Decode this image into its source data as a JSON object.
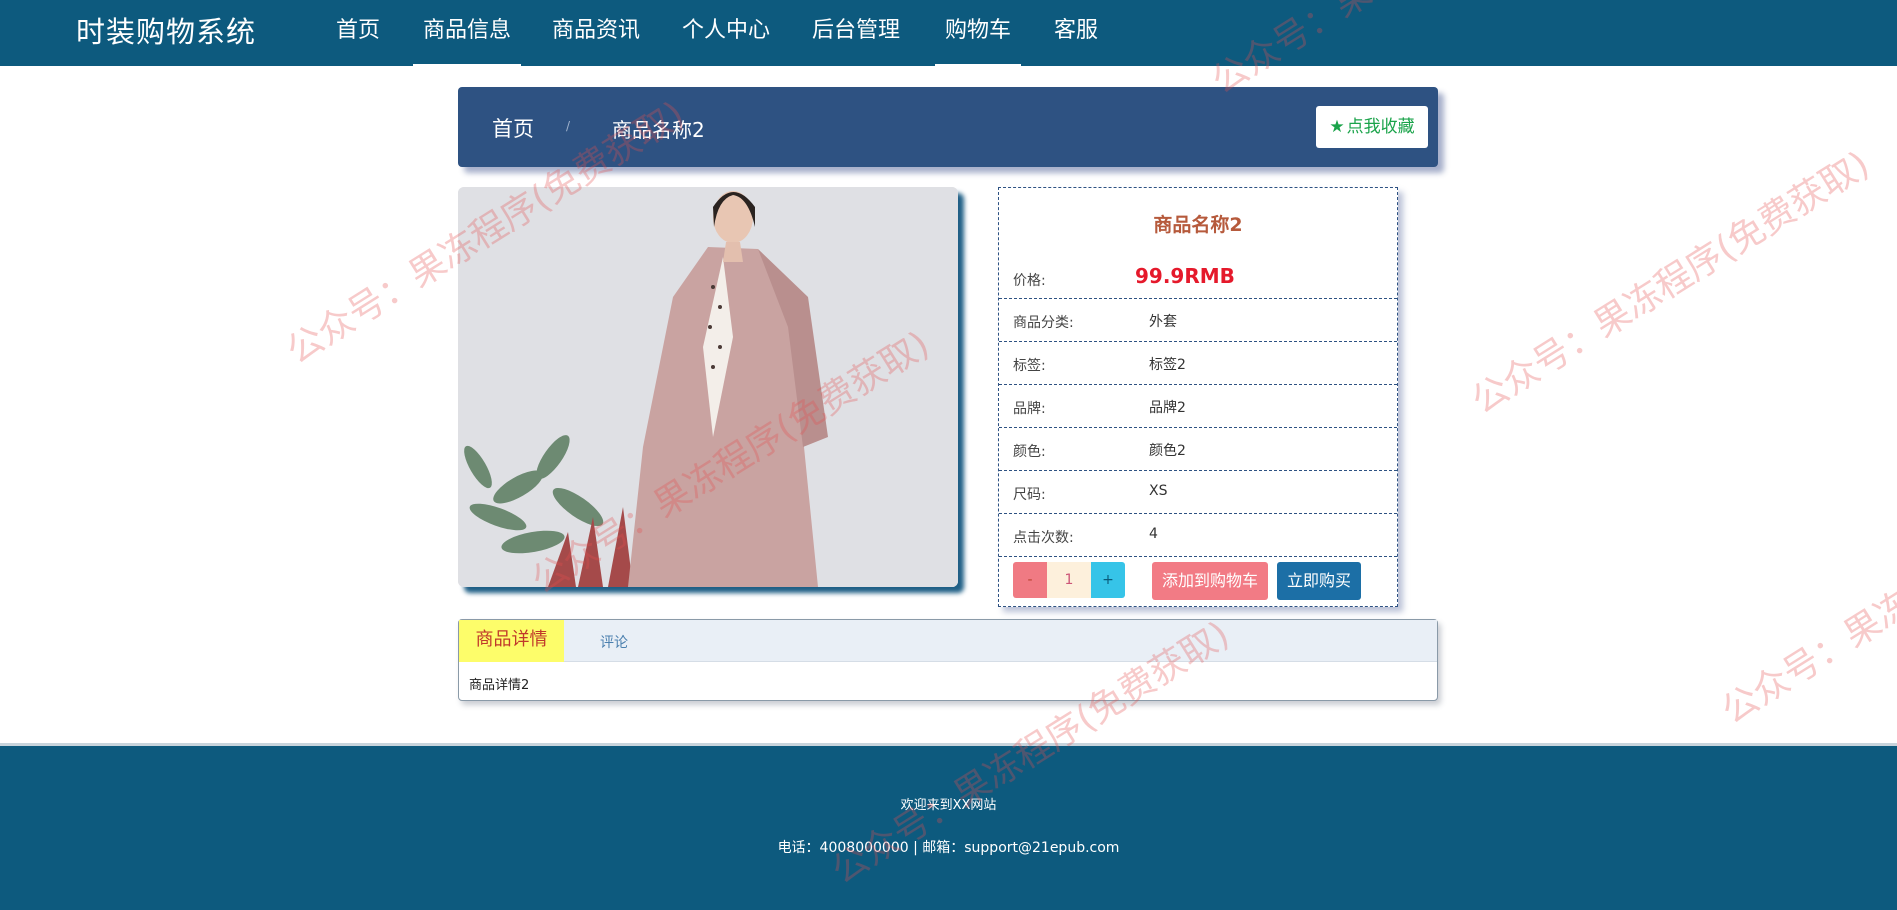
{
  "brand": "时装购物系统",
  "nav": {
    "items": [
      {
        "label": "首页",
        "active": false
      },
      {
        "label": "商品信息",
        "active": true
      },
      {
        "label": "商品资讯",
        "active": false
      },
      {
        "label": "个人中心",
        "active": false
      },
      {
        "label": "后台管理",
        "active": false
      },
      {
        "label": "购物车",
        "active": true
      },
      {
        "label": "客服",
        "active": false
      }
    ]
  },
  "breadcrumb": {
    "home": "首页",
    "separator": "/",
    "current": "商品名称2"
  },
  "favorite": {
    "label": "点我收藏",
    "icon": "star-icon"
  },
  "product": {
    "image_icon": "product-photo",
    "title": "商品名称2",
    "price_label": "价格:",
    "price": "99.9RMB",
    "fields": [
      {
        "label": "商品分类:",
        "value": "外套"
      },
      {
        "label": "标签:",
        "value": "标签2"
      },
      {
        "label": "品牌:",
        "value": "品牌2"
      },
      {
        "label": "颜色:",
        "value": "颜色2"
      },
      {
        "label": "尺码:",
        "value": "XS"
      },
      {
        "label": "点击次数:",
        "value": "4"
      }
    ],
    "quantity": {
      "minus": "-",
      "value": "1",
      "plus": "+"
    },
    "add_to_cart": "添加到购物车",
    "buy_now": "立即购买"
  },
  "tabs": {
    "detail": "商品详情",
    "review": "评论",
    "content": "商品详情2"
  },
  "footer": {
    "welcome": "欢迎来到XX网站",
    "contact": "电话：4008000000 | 邮箱：support@21epub.com"
  },
  "watermark": "公众号：果冻程序(免费获取)",
  "colors": {
    "nav_bg": "#0d5a7e",
    "breadcrumb_bg": "#2e5282",
    "price": "#e5192b",
    "title": "#b65a3c",
    "cart_button": "#f27b85",
    "buy_button": "#1c6fa6",
    "active_tab": "#fdfd6a"
  }
}
